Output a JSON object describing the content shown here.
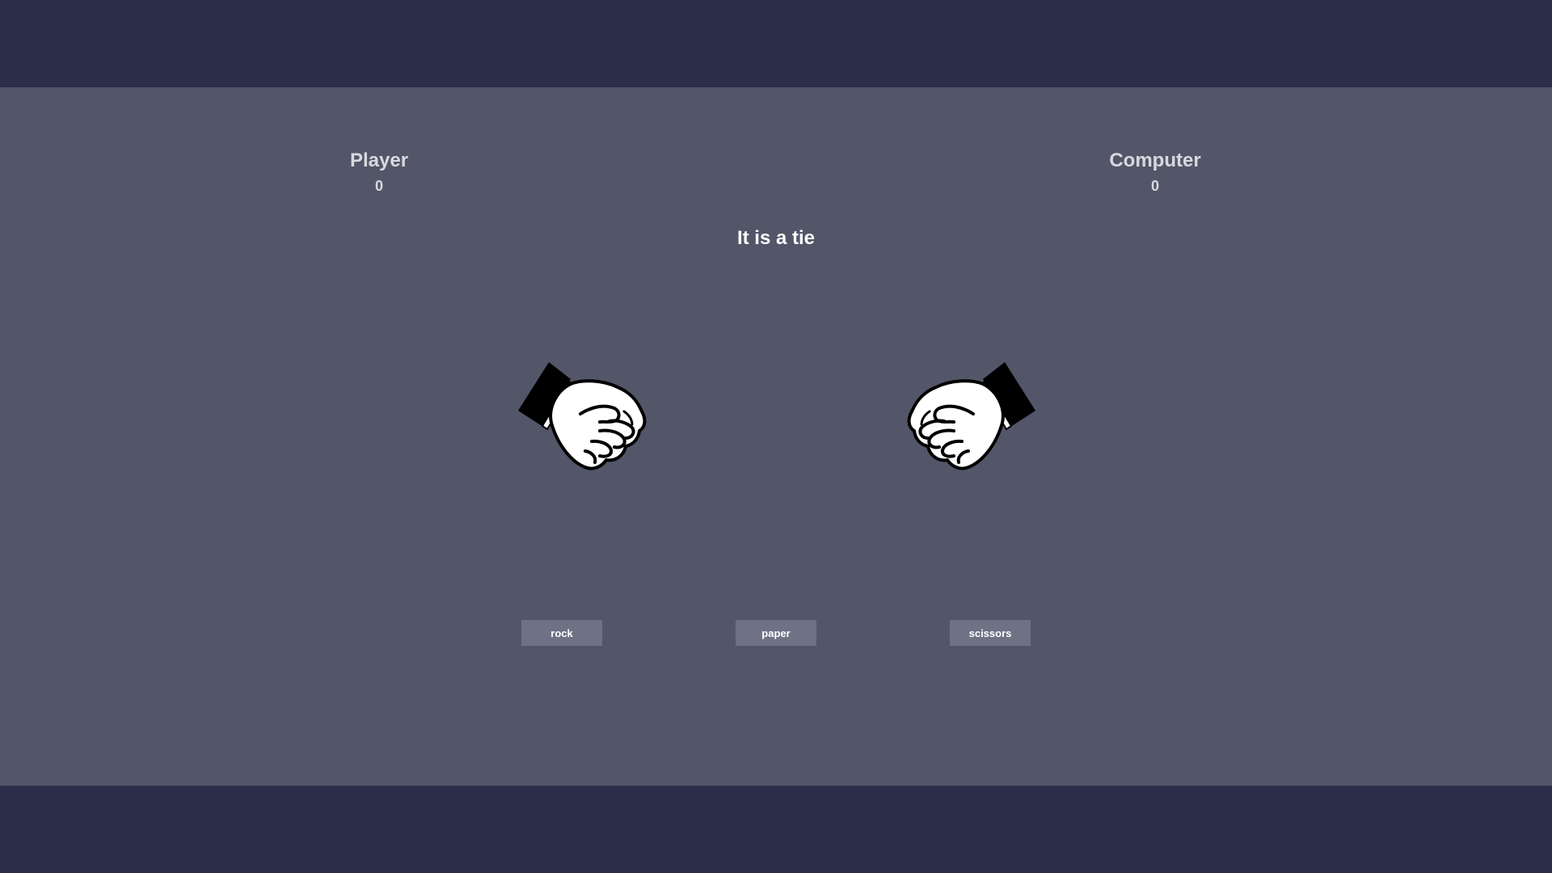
{
  "scoreboard": {
    "player": {
      "label": "Player",
      "score": "0"
    },
    "computer": {
      "label": "Computer",
      "score": "0"
    }
  },
  "result_text": "It is a tie",
  "hands": {
    "player": {
      "choice": "rock",
      "icon": "fist-icon"
    },
    "computer": {
      "choice": "rock",
      "icon": "fist-icon"
    }
  },
  "buttons": {
    "rock": "rock",
    "paper": "paper",
    "scissors": "scissors"
  },
  "colors": {
    "frame": "#2c2d49",
    "stage": "#535668",
    "button": "#6f7285",
    "score_text": "#d8d9e0",
    "result_text": "#ffffff"
  }
}
